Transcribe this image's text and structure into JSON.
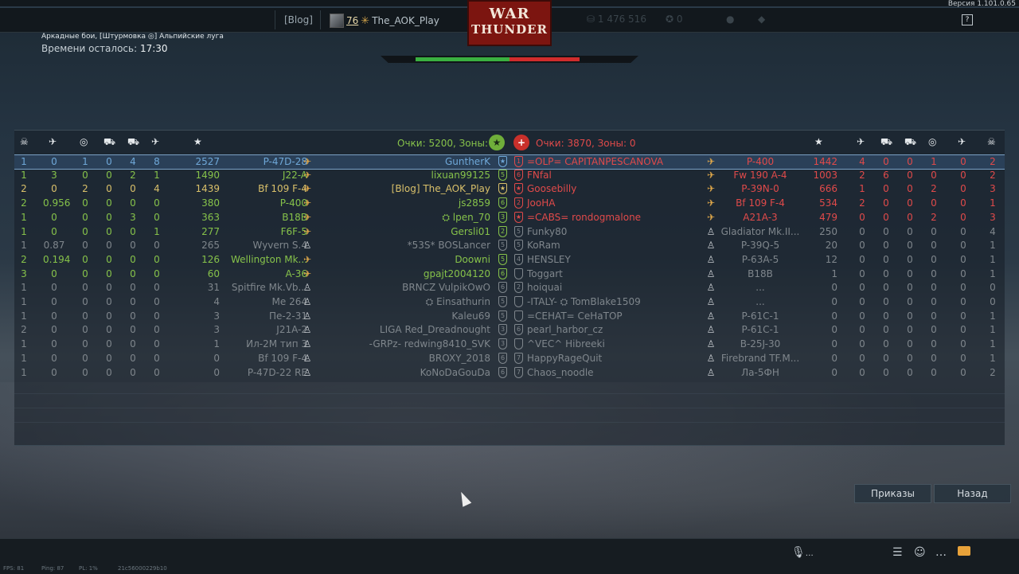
{
  "topbar": {
    "version": "Версия 1.101.0.65",
    "blog_label": "[Blog]",
    "player": {
      "level": "76",
      "name": "The_AOK_Play"
    },
    "logo": {
      "line1": "WAR",
      "line2": "THUNDER"
    },
    "silver_lions": "1 476 516",
    "eagles": "0",
    "help": "?"
  },
  "mission": {
    "title": "Аркадные бои, [Штурмовка ◎] Альпийские луга",
    "time_label": "Времени осталось:",
    "time_value": "17:30"
  },
  "score": {
    "left": "Очки: 5200, Зоны: 0",
    "right": "Очки: 3870, Зоны: 0"
  },
  "header_icons": {
    "deaths": "☠",
    "aircraft": "✈",
    "assists": "◎",
    "tanks": "⛟",
    "light": "⛟",
    "air": "✈",
    "score": "★"
  },
  "left_team": [
    {
      "c": [
        "1",
        "0",
        "1",
        "0",
        "4",
        "8"
      ],
      "score": "2527",
      "vehicle": "P-47D-28",
      "name": "GuntherK",
      "rank": "★",
      "style": "blue",
      "sel": true
    },
    {
      "c": [
        "1",
        "3",
        "0",
        "0",
        "2",
        "1"
      ],
      "score": "1490",
      "vehicle": "J22-A",
      "name": "lixuan99125",
      "rank": "5",
      "style": "green"
    },
    {
      "c": [
        "2",
        "0",
        "2",
        "0",
        "0",
        "4"
      ],
      "score": "1439",
      "vehicle": "Bf 109 F-4",
      "name": "[Blog] The_AOK_Play",
      "rank": "★",
      "style": "yellow"
    },
    {
      "c": [
        "2",
        "0.956",
        "0",
        "0",
        "0",
        "0"
      ],
      "score": "380",
      "vehicle": "P-400",
      "name": "js2859",
      "rank": "6",
      "style": "green"
    },
    {
      "c": [
        "1",
        "0",
        "0",
        "0",
        "3",
        "0"
      ],
      "score": "363",
      "vehicle": "B18B",
      "name": "⛭ lpen_70",
      "rank": "3",
      "style": "green"
    },
    {
      "c": [
        "1",
        "0",
        "0",
        "0",
        "0",
        "1"
      ],
      "score": "277",
      "vehicle": "F6F-5",
      "name": "Gersli01",
      "rank": "2",
      "style": "green"
    },
    {
      "c": [
        "1",
        "0.87",
        "0",
        "0",
        "0",
        "0"
      ],
      "score": "265",
      "vehicle": "Wyvern S.4",
      "name": "*53S* BOSLancer",
      "rank": "5",
      "style": "gray"
    },
    {
      "c": [
        "2",
        "0.194",
        "0",
        "0",
        "0",
        "0"
      ],
      "score": "126",
      "vehicle": "Wellington Mk...",
      "name": "Doowni",
      "rank": "5",
      "style": "green"
    },
    {
      "c": [
        "3",
        "0",
        "0",
        "0",
        "0",
        "0"
      ],
      "score": "60",
      "vehicle": "A-36",
      "name": "gpajt2004120",
      "rank": "6",
      "style": "green"
    },
    {
      "c": [
        "1",
        "0",
        "0",
        "0",
        "0",
        "0"
      ],
      "score": "31",
      "vehicle": "Spitfire Mk.Vb...",
      "name": "BRNCZ VulpikOwO",
      "rank": "6",
      "style": "gray"
    },
    {
      "c": [
        "1",
        "0",
        "0",
        "0",
        "0",
        "0"
      ],
      "score": "4",
      "vehicle": "Me 264",
      "name": "⛭ Einsathurin",
      "rank": "5",
      "style": "gray"
    },
    {
      "c": [
        "1",
        "0",
        "0",
        "0",
        "0",
        "0"
      ],
      "score": "3",
      "vehicle": "Пе-2-31",
      "name": "Kaleu69",
      "rank": "5",
      "style": "gray"
    },
    {
      "c": [
        "2",
        "0",
        "0",
        "0",
        "0",
        "0"
      ],
      "score": "3",
      "vehicle": "J21A-2",
      "name": "LIGA Red_Dreadnought",
      "rank": "3",
      "style": "gray"
    },
    {
      "c": [
        "1",
        "0",
        "0",
        "0",
        "0",
        "0"
      ],
      "score": "1",
      "vehicle": "Ил-2М тип 3",
      "name": "-GRPz- redwing8410_SVK",
      "rank": "3",
      "style": "gray"
    },
    {
      "c": [
        "1",
        "0",
        "0",
        "0",
        "0",
        "0"
      ],
      "score": "0",
      "vehicle": "Bf 109 F-4",
      "name": "BROXY_2018",
      "rank": "6",
      "style": "gray"
    },
    {
      "c": [
        "1",
        "0",
        "0",
        "0",
        "0",
        "0"
      ],
      "score": "0",
      "vehicle": "P-47D-22 RE",
      "name": "KoNoDaGouDa",
      "rank": "6",
      "style": "gray"
    }
  ],
  "right_team": [
    {
      "name": "=OLP= CAPITANPESCANOVA",
      "rank": "1",
      "vehicle": "P-400",
      "score": "1442",
      "c": [
        "4",
        "0",
        "0",
        "1",
        "0",
        "2"
      ],
      "style": "red"
    },
    {
      "name": "FNfal",
      "rank": "6",
      "vehicle": "Fw 190 A-4",
      "score": "1003",
      "c": [
        "2",
        "6",
        "0",
        "0",
        "0",
        "2"
      ],
      "style": "red"
    },
    {
      "name": "Goosebilly",
      "rank": "★",
      "vehicle": "P-39N-0",
      "score": "666",
      "c": [
        "1",
        "0",
        "0",
        "2",
        "0",
        "3"
      ],
      "style": "red"
    },
    {
      "name": "JooHA",
      "rank": "2",
      "vehicle": "Bf 109 F-4",
      "score": "534",
      "c": [
        "2",
        "0",
        "0",
        "0",
        "0",
        "1"
      ],
      "style": "red"
    },
    {
      "name": "=CABS= rondogmalone",
      "rank": "★",
      "vehicle": "A21A-3",
      "score": "479",
      "c": [
        "0",
        "0",
        "0",
        "2",
        "0",
        "3"
      ],
      "style": "red"
    },
    {
      "name": "Funky80",
      "rank": "5",
      "vehicle": "Gladiator Mk.II...",
      "score": "250",
      "c": [
        "0",
        "0",
        "0",
        "0",
        "0",
        "4"
      ],
      "style": "gray"
    },
    {
      "name": "KoRam",
      "rank": "5",
      "vehicle": "P-39Q-5",
      "score": "20",
      "c": [
        "0",
        "0",
        "0",
        "0",
        "0",
        "1"
      ],
      "style": "gray"
    },
    {
      "name": "HENSLEY",
      "rank": "4",
      "vehicle": "P-63A-5",
      "score": "12",
      "c": [
        "0",
        "0",
        "0",
        "0",
        "0",
        "1"
      ],
      "style": "gray"
    },
    {
      "name": "Toggart",
      "rank": "",
      "vehicle": "B18B",
      "score": "1",
      "c": [
        "0",
        "0",
        "0",
        "0",
        "0",
        "1"
      ],
      "style": "gray"
    },
    {
      "name": "hoiquai",
      "rank": "2",
      "vehicle": "...",
      "score": "0",
      "c": [
        "0",
        "0",
        "0",
        "0",
        "0",
        "0"
      ],
      "style": "gray"
    },
    {
      "name": "-ITALY- ⛭ TomBlake1509",
      "rank": "",
      "vehicle": "...",
      "score": "0",
      "c": [
        "0",
        "0",
        "0",
        "0",
        "0",
        "0"
      ],
      "style": "gray"
    },
    {
      "name": "=CEHAT= CeHaTOP",
      "rank": "",
      "vehicle": "P-61C-1",
      "score": "0",
      "c": [
        "0",
        "0",
        "0",
        "0",
        "0",
        "1"
      ],
      "style": "gray"
    },
    {
      "name": "pearl_harbor_cz",
      "rank": "6",
      "vehicle": "P-61C-1",
      "score": "0",
      "c": [
        "0",
        "0",
        "0",
        "0",
        "0",
        "1"
      ],
      "style": "gray"
    },
    {
      "name": "^VEC^ Hibreeki",
      "rank": "",
      "vehicle": "B-25J-30",
      "score": "0",
      "c": [
        "0",
        "0",
        "0",
        "0",
        "0",
        "1"
      ],
      "style": "gray"
    },
    {
      "name": "HappyRageQuit",
      "rank": "7",
      "vehicle": "Firebrand TF.M...",
      "score": "0",
      "c": [
        "0",
        "0",
        "0",
        "0",
        "0",
        "1"
      ],
      "style": "gray"
    },
    {
      "name": "Chaos_noodle",
      "rank": "7",
      "vehicle": "Ла-5ФН",
      "score": "0",
      "c": [
        "0",
        "0",
        "0",
        "0",
        "0",
        "2"
      ],
      "style": "gray"
    }
  ],
  "buttons": {
    "orders": "Приказы",
    "back": "Назад"
  },
  "status": {
    "fps": "FPS: 81",
    "ping": "Ping: 87",
    "pl": "PL: 1%",
    "session": "21c56000229b10"
  },
  "voice": "…",
  "colors": {
    "green": "#86c24a",
    "red": "#e04a4a",
    "blue": "#6fa8d8",
    "yellow": "#d9c06a",
    "gray": "#7f868c"
  }
}
